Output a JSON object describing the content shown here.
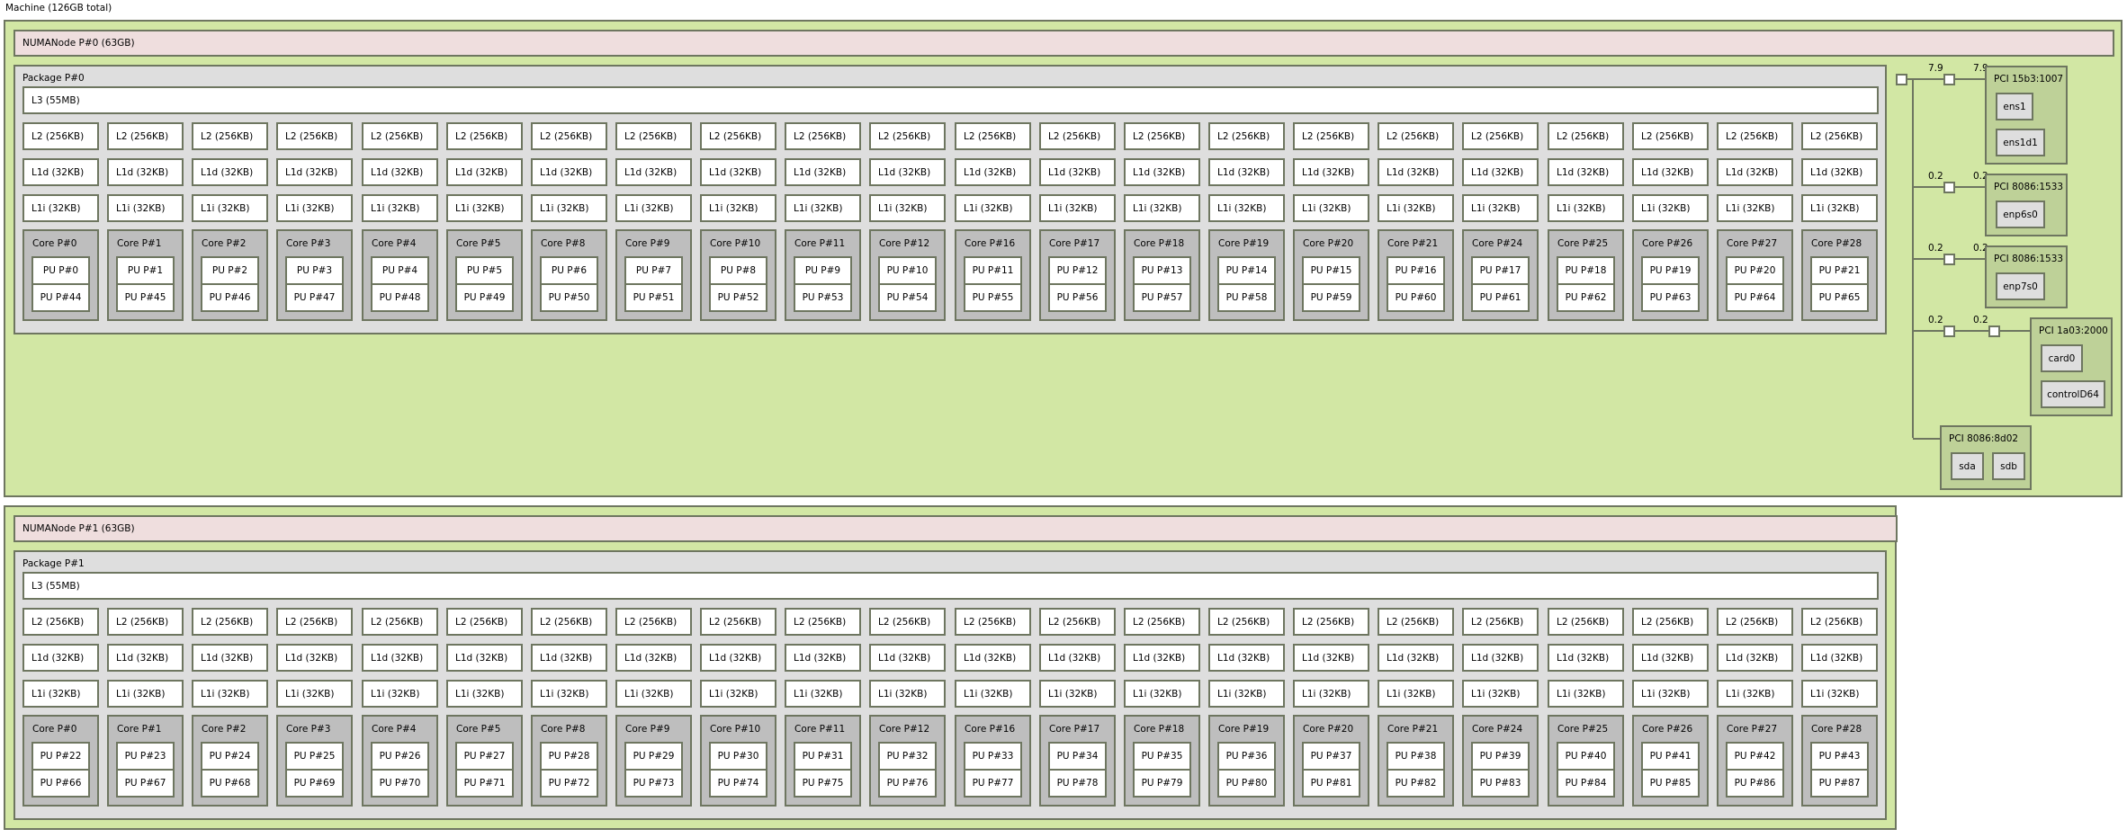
{
  "machine": {
    "title": "Machine (126GB total)"
  },
  "numa_nodes": [
    {
      "label": "NUMANode P#0 (63GB)",
      "package": {
        "label": "Package P#0",
        "l3": "L3 (55MB)",
        "l2": "L2 (256KB)",
        "l1d": "L1d (32KB)",
        "l1i": "L1i (32KB)",
        "cores": [
          {
            "label": "Core P#0",
            "pus": [
              "PU P#0",
              "PU P#44"
            ]
          },
          {
            "label": "Core P#1",
            "pus": [
              "PU P#1",
              "PU P#45"
            ]
          },
          {
            "label": "Core P#2",
            "pus": [
              "PU P#2",
              "PU P#46"
            ]
          },
          {
            "label": "Core P#3",
            "pus": [
              "PU P#3",
              "PU P#47"
            ]
          },
          {
            "label": "Core P#4",
            "pus": [
              "PU P#4",
              "PU P#48"
            ]
          },
          {
            "label": "Core P#5",
            "pus": [
              "PU P#5",
              "PU P#49"
            ]
          },
          {
            "label": "Core P#8",
            "pus": [
              "PU P#6",
              "PU P#50"
            ]
          },
          {
            "label": "Core P#9",
            "pus": [
              "PU P#7",
              "PU P#51"
            ]
          },
          {
            "label": "Core P#10",
            "pus": [
              "PU P#8",
              "PU P#52"
            ]
          },
          {
            "label": "Core P#11",
            "pus": [
              "PU P#9",
              "PU P#53"
            ]
          },
          {
            "label": "Core P#12",
            "pus": [
              "PU P#10",
              "PU P#54"
            ]
          },
          {
            "label": "Core P#16",
            "pus": [
              "PU P#11",
              "PU P#55"
            ]
          },
          {
            "label": "Core P#17",
            "pus": [
              "PU P#12",
              "PU P#56"
            ]
          },
          {
            "label": "Core P#18",
            "pus": [
              "PU P#13",
              "PU P#57"
            ]
          },
          {
            "label": "Core P#19",
            "pus": [
              "PU P#14",
              "PU P#58"
            ]
          },
          {
            "label": "Core P#20",
            "pus": [
              "PU P#15",
              "PU P#59"
            ]
          },
          {
            "label": "Core P#21",
            "pus": [
              "PU P#16",
              "PU P#60"
            ]
          },
          {
            "label": "Core P#24",
            "pus": [
              "PU P#17",
              "PU P#61"
            ]
          },
          {
            "label": "Core P#25",
            "pus": [
              "PU P#18",
              "PU P#62"
            ]
          },
          {
            "label": "Core P#26",
            "pus": [
              "PU P#19",
              "PU P#63"
            ]
          },
          {
            "label": "Core P#27",
            "pus": [
              "PU P#20",
              "PU P#64"
            ]
          },
          {
            "label": "Core P#28",
            "pus": [
              "PU P#21",
              "PU P#65"
            ]
          }
        ]
      },
      "pci_tree": {
        "links": [
          {
            "left_value": "7.9",
            "right_value": "7.9"
          },
          {
            "left_value": "0.2",
            "right_value": "0.2"
          },
          {
            "left_value": "0.2",
            "right_value": "0.2"
          },
          {
            "left_value": "0.2",
            "right_value": "0.2"
          }
        ],
        "devices": [
          {
            "label": "PCI 15b3:1007",
            "osdevs": [
              "ens1",
              "ens1d1"
            ]
          },
          {
            "label": "PCI 8086:1533",
            "osdevs": [
              "enp6s0"
            ]
          },
          {
            "label": "PCI 8086:1533",
            "osdevs": [
              "enp7s0"
            ]
          },
          {
            "label": "PCI 1a03:2000",
            "osdevs": [
              "card0",
              "controlD64"
            ]
          },
          {
            "label": "PCI 8086:8d02",
            "osdevs": [
              "sda",
              "sdb"
            ]
          }
        ]
      }
    },
    {
      "label": "NUMANode P#1 (63GB)",
      "package": {
        "label": "Package P#1",
        "l3": "L3 (55MB)",
        "l2": "L2 (256KB)",
        "l1d": "L1d (32KB)",
        "l1i": "L1i (32KB)",
        "cores": [
          {
            "label": "Core P#0",
            "pus": [
              "PU P#22",
              "PU P#66"
            ]
          },
          {
            "label": "Core P#1",
            "pus": [
              "PU P#23",
              "PU P#67"
            ]
          },
          {
            "label": "Core P#2",
            "pus": [
              "PU P#24",
              "PU P#68"
            ]
          },
          {
            "label": "Core P#3",
            "pus": [
              "PU P#25",
              "PU P#69"
            ]
          },
          {
            "label": "Core P#4",
            "pus": [
              "PU P#26",
              "PU P#70"
            ]
          },
          {
            "label": "Core P#5",
            "pus": [
              "PU P#27",
              "PU P#71"
            ]
          },
          {
            "label": "Core P#8",
            "pus": [
              "PU P#28",
              "PU P#72"
            ]
          },
          {
            "label": "Core P#9",
            "pus": [
              "PU P#29",
              "PU P#73"
            ]
          },
          {
            "label": "Core P#10",
            "pus": [
              "PU P#30",
              "PU P#74"
            ]
          },
          {
            "label": "Core P#11",
            "pus": [
              "PU P#31",
              "PU P#75"
            ]
          },
          {
            "label": "Core P#12",
            "pus": [
              "PU P#32",
              "PU P#76"
            ]
          },
          {
            "label": "Core P#16",
            "pus": [
              "PU P#33",
              "PU P#77"
            ]
          },
          {
            "label": "Core P#17",
            "pus": [
              "PU P#34",
              "PU P#78"
            ]
          },
          {
            "label": "Core P#18",
            "pus": [
              "PU P#35",
              "PU P#79"
            ]
          },
          {
            "label": "Core P#19",
            "pus": [
              "PU P#36",
              "PU P#80"
            ]
          },
          {
            "label": "Core P#20",
            "pus": [
              "PU P#37",
              "PU P#81"
            ]
          },
          {
            "label": "Core P#21",
            "pus": [
              "PU P#38",
              "PU P#82"
            ]
          },
          {
            "label": "Core P#24",
            "pus": [
              "PU P#39",
              "PU P#83"
            ]
          },
          {
            "label": "Core P#25",
            "pus": [
              "PU P#40",
              "PU P#84"
            ]
          },
          {
            "label": "Core P#26",
            "pus": [
              "PU P#41",
              "PU P#85"
            ]
          },
          {
            "label": "Core P#27",
            "pus": [
              "PU P#42",
              "PU P#86"
            ]
          },
          {
            "label": "Core P#28",
            "pus": [
              "PU P#43",
              "PU P#87"
            ]
          }
        ]
      }
    }
  ]
}
